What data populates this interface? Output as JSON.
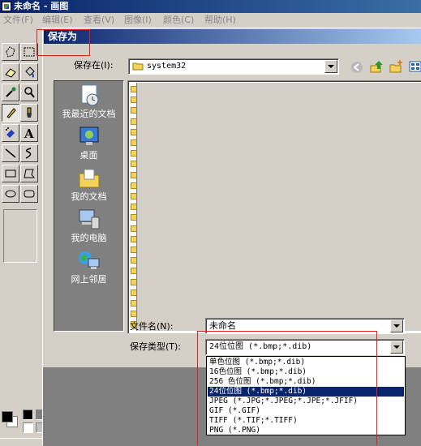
{
  "window": {
    "title": "未命名 - 画图"
  },
  "menu": [
    "文件(F)",
    "编辑(E)",
    "查看(V)",
    "图像(I)",
    "颜色(C)",
    "帮助(H)"
  ],
  "toolbox": {
    "tools": [
      "free-select",
      "rect-select",
      "eraser",
      "fill",
      "color-picker",
      "magnifier",
      "pencil",
      "brush",
      "airbrush",
      "text",
      "line",
      "curve",
      "rectangle",
      "polygon",
      "ellipse",
      "rounded-rectangle"
    ],
    "active_tool": "pencil"
  },
  "palette": {
    "foreground": "#000000",
    "background": "#ffffff",
    "row1": [
      "#000000",
      "#808080",
      "#800000",
      "#808000",
      "#008000",
      "#008080",
      "#000080",
      "#800080",
      "#808040",
      "#004040",
      "#0080ff",
      "#004080",
      "#8000ff",
      "#804000"
    ],
    "row2": [
      "#ffffff",
      "#c0c0c0",
      "#ff0000",
      "#ffff00",
      "#00ff00",
      "#00ffff",
      "#0000ff",
      "#ff00ff",
      "#ffff80",
      "#00ff80",
      "#80ffff",
      "#8080ff",
      "#ff0080",
      "#ff8040"
    ]
  },
  "dialog": {
    "title": "保存为",
    "save_in_label": "保存在(I):",
    "save_in_value": "system32",
    "places": [
      {
        "label": "我最近的文档",
        "icon": "recent-documents-icon"
      },
      {
        "label": "桌面",
        "icon": "desktop-icon"
      },
      {
        "label": "我的文档",
        "icon": "my-documents-icon"
      },
      {
        "label": "我的电脑",
        "icon": "my-computer-icon"
      },
      {
        "label": "网上邻居",
        "icon": "network-places-icon"
      }
    ],
    "filename_label": "文件名(N):",
    "filename_value": "未命名",
    "filetype_label": "保存类型(T):",
    "filetype_value": "24位位图 (*.bmp;*.dib)",
    "filetype_options": [
      "单色位图 (*.bmp;*.dib)",
      "16色位图 (*.bmp;*.dib)",
      "256 色位图 (*.bmp;*.dib)",
      "24位位图 (*.bmp;*.dib)",
      "JPEG (*.JPG;*.JPEG;*.JPE;*.JFIF)",
      "GIF (*.GIF)",
      "TIFF (*.TIF;*.TIFF)",
      "PNG (*.PNG)"
    ],
    "filetype_selected_index": 3
  },
  "colors": {
    "highlight": "#e02020",
    "selection": "#0a246a",
    "title_blue": "#0a246a"
  }
}
